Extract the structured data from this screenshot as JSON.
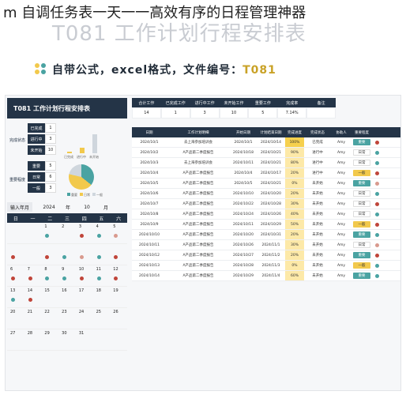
{
  "headline": "m 自调任务表一天一一高效有序的日程管理神器",
  "watermark_title": "T081 工作计划行程安排表",
  "sub_banner": {
    "text": "自带公式，excel格式，文件编号：",
    "code": "T081",
    "icon_colors": [
      "#f2c94c",
      "#4aa3a2",
      "#f2c94c",
      "#4aa3a2"
    ]
  },
  "left": {
    "header": "T081 工作计划行程安排表",
    "status_block": {
      "category": "完成状态",
      "rows": [
        {
          "label": "已完成",
          "value": "1"
        },
        {
          "label": "进行中",
          "value": "3"
        },
        {
          "label": "未开始",
          "value": "10"
        }
      ],
      "bars": [
        0.07,
        0.21,
        0.71
      ],
      "bar_legend": [
        "已完成",
        "进行中",
        "未开始"
      ]
    },
    "priority_block": {
      "category": "重要程度",
      "rows": [
        {
          "label": "重要",
          "value": "5"
        },
        {
          "label": "日常",
          "value": "6"
        },
        {
          "label": "一般",
          "value": "3"
        }
      ],
      "pie_colors": [
        "#4aa3a2",
        "#f2c94c",
        "#cfd6dd"
      ],
      "pie_values": [
        5,
        6,
        3
      ],
      "pie_legend": [
        "重要",
        "日常",
        "一般"
      ]
    },
    "year_label": "输入年月",
    "year_value": "2024",
    "year_unit": "年",
    "month_value": "10",
    "month_unit": "月",
    "weekdays": [
      "日",
      "一",
      "二",
      "三",
      "四",
      "五",
      "六"
    ],
    "calendar": [
      {
        "d": "",
        "c": ""
      },
      {
        "d": "",
        "c": ""
      },
      {
        "d": "1",
        "c": "#4aa3a2"
      },
      {
        "d": "2",
        "c": ""
      },
      {
        "d": "3",
        "c": "#c0453a"
      },
      {
        "d": "4",
        "c": "#4aa3a2"
      },
      {
        "d": "5",
        "c": "#d99a8e"
      },
      {
        "d": "",
        "c": "#c0453a"
      },
      {
        "d": "",
        "c": ""
      },
      {
        "d": "",
        "c": "#c0453a"
      },
      {
        "d": "",
        "c": "#4aa3a2"
      },
      {
        "d": "",
        "c": "#d99a8e"
      },
      {
        "d": "",
        "c": "#4aa3a2"
      },
      {
        "d": "",
        "c": "#c0453a"
      },
      {
        "d": "6",
        "c": "#c0453a"
      },
      {
        "d": "7",
        "c": "#c0453a"
      },
      {
        "d": "8",
        "c": "#4aa3a2"
      },
      {
        "d": "9",
        "c": "#4aa3a2"
      },
      {
        "d": "10",
        "c": "#c0453a"
      },
      {
        "d": "11",
        "c": "#4aa3a2"
      },
      {
        "d": "12",
        "c": "#c0453a"
      },
      {
        "d": "13",
        "c": "#4aa3a2"
      },
      {
        "d": "14",
        "c": "#c0453a"
      },
      {
        "d": "15",
        "c": ""
      },
      {
        "d": "16",
        "c": ""
      },
      {
        "d": "17",
        "c": ""
      },
      {
        "d": "18",
        "c": ""
      },
      {
        "d": "19",
        "c": ""
      },
      {
        "d": "20",
        "c": ""
      },
      {
        "d": "21",
        "c": ""
      },
      {
        "d": "22",
        "c": ""
      },
      {
        "d": "23",
        "c": ""
      },
      {
        "d": "24",
        "c": ""
      },
      {
        "d": "25",
        "c": ""
      },
      {
        "d": "26",
        "c": ""
      },
      {
        "d": "27",
        "c": ""
      },
      {
        "d": "28",
        "c": ""
      },
      {
        "d": "29",
        "c": ""
      },
      {
        "d": "30",
        "c": ""
      },
      {
        "d": "31",
        "c": ""
      },
      {
        "d": "",
        "c": ""
      },
      {
        "d": "",
        "c": ""
      }
    ]
  },
  "summary": {
    "headers": [
      "合计工作",
      "已完成工作",
      "进行中工作",
      "未开始工作",
      "重要工作",
      "完成率",
      "备注"
    ],
    "values": [
      "14",
      "1",
      "3",
      "10",
      "5",
      "7.14%",
      ""
    ]
  },
  "tasks": {
    "headers": [
      "日期",
      "工作计划明细",
      "开始日期",
      "计划结束日期",
      "完成进度",
      "完成状态",
      "协助人",
      "重要程度",
      "",
      ""
    ],
    "rows": [
      {
        "date": "2024/10/1",
        "task": "去上海参加培训会",
        "start": "2024/10/1",
        "end": "2024/10/14",
        "pct": "100%",
        "status": "已完成",
        "who": "Amy",
        "prio": "重要",
        "prio_color": "#4aa3a2",
        "dot": "#c0453a"
      },
      {
        "date": "2024/10/2",
        "task": "A产品第二季度报告",
        "start": "2024/10/18",
        "end": "2024/10/21",
        "pct": "90%",
        "status": "进行中",
        "who": "Amy",
        "prio": "日常",
        "prio_color": "#ffffff",
        "dot": "#4aa3a2"
      },
      {
        "date": "2024/10/3",
        "task": "去上海参加培训会",
        "start": "2024/10/11",
        "end": "2024/10/21",
        "pct": "80%",
        "status": "进行中",
        "who": "Amy",
        "prio": "日常",
        "prio_color": "#ffffff",
        "dot": "#4aa3a2"
      },
      {
        "date": "2024/10/4",
        "task": "A产品第二季度报告",
        "start": "2024/10/4",
        "end": "2024/10/17",
        "pct": "20%",
        "status": "进行中",
        "who": "Amy",
        "prio": "一般",
        "prio_color": "#f2c94c",
        "dot": "#c0453a"
      },
      {
        "date": "2024/10/5",
        "task": "A产品第二季度报告",
        "start": "2024/10/5",
        "end": "2024/10/21",
        "pct": "0%",
        "status": "未开始",
        "who": "Amy",
        "prio": "重要",
        "prio_color": "#4aa3a2",
        "dot": "#d99a8e"
      },
      {
        "date": "2024/10/6",
        "task": "A产品第二季度报告",
        "start": "2024/10/10",
        "end": "2024/10/20",
        "pct": "20%",
        "status": "未开始",
        "who": "Amy",
        "prio": "日常",
        "prio_color": "#ffffff",
        "dot": "#4aa3a2"
      },
      {
        "date": "2024/10/7",
        "task": "A产品第二季度报告",
        "start": "2024/10/22",
        "end": "2024/10/28",
        "pct": "30%",
        "status": "未开始",
        "who": "Amy",
        "prio": "日常",
        "prio_color": "#ffffff",
        "dot": "#c0453a"
      },
      {
        "date": "2024/10/8",
        "task": "A产品第二季度报告",
        "start": "2024/10/24",
        "end": "2024/10/26",
        "pct": "40%",
        "status": "未开始",
        "who": "Amy",
        "prio": "日常",
        "prio_color": "#ffffff",
        "dot": "#4aa3a2"
      },
      {
        "date": "2024/10/9",
        "task": "A产品第二季度报告",
        "start": "2024/10/11",
        "end": "2024/10/29",
        "pct": "50%",
        "status": "未开始",
        "who": "Amy",
        "prio": "一般",
        "prio_color": "#f2c94c",
        "dot": "#c0453a"
      },
      {
        "date": "2024/10/10",
        "task": "A产品第二季度报告",
        "start": "2024/10/20",
        "end": "2024/10/31",
        "pct": "20%",
        "status": "未开始",
        "who": "Amy",
        "prio": "重要",
        "prio_color": "#4aa3a2",
        "dot": "#4aa3a2"
      },
      {
        "date": "2024/10/11",
        "task": "A产品第二季度报告",
        "start": "2024/10/26",
        "end": "2024/11/1",
        "pct": "30%",
        "status": "未开始",
        "who": "Amy",
        "prio": "日常",
        "prio_color": "#ffffff",
        "dot": "#d99a8e"
      },
      {
        "date": "2024/10/12",
        "task": "A产品第二季度报告",
        "start": "2024/10/27",
        "end": "2024/11/2",
        "pct": "20%",
        "status": "未开始",
        "who": "Amy",
        "prio": "重要",
        "prio_color": "#4aa3a2",
        "dot": "#c0453a"
      },
      {
        "date": "2024/10/13",
        "task": "A产品第二季度报告",
        "start": "2024/10/28",
        "end": "2024/11/3",
        "pct": "0%",
        "status": "未开始",
        "who": "Amy",
        "prio": "一般",
        "prio_color": "#f2c94c",
        "dot": "#4aa3a2"
      },
      {
        "date": "2024/10/14",
        "task": "A产品第二季度报告",
        "start": "2024/10/29",
        "end": "2024/11/4",
        "pct": "60%",
        "status": "未开始",
        "who": "Amy",
        "prio": "重要",
        "prio_color": "#4aa3a2",
        "dot": "#4aa3a2"
      }
    ]
  }
}
